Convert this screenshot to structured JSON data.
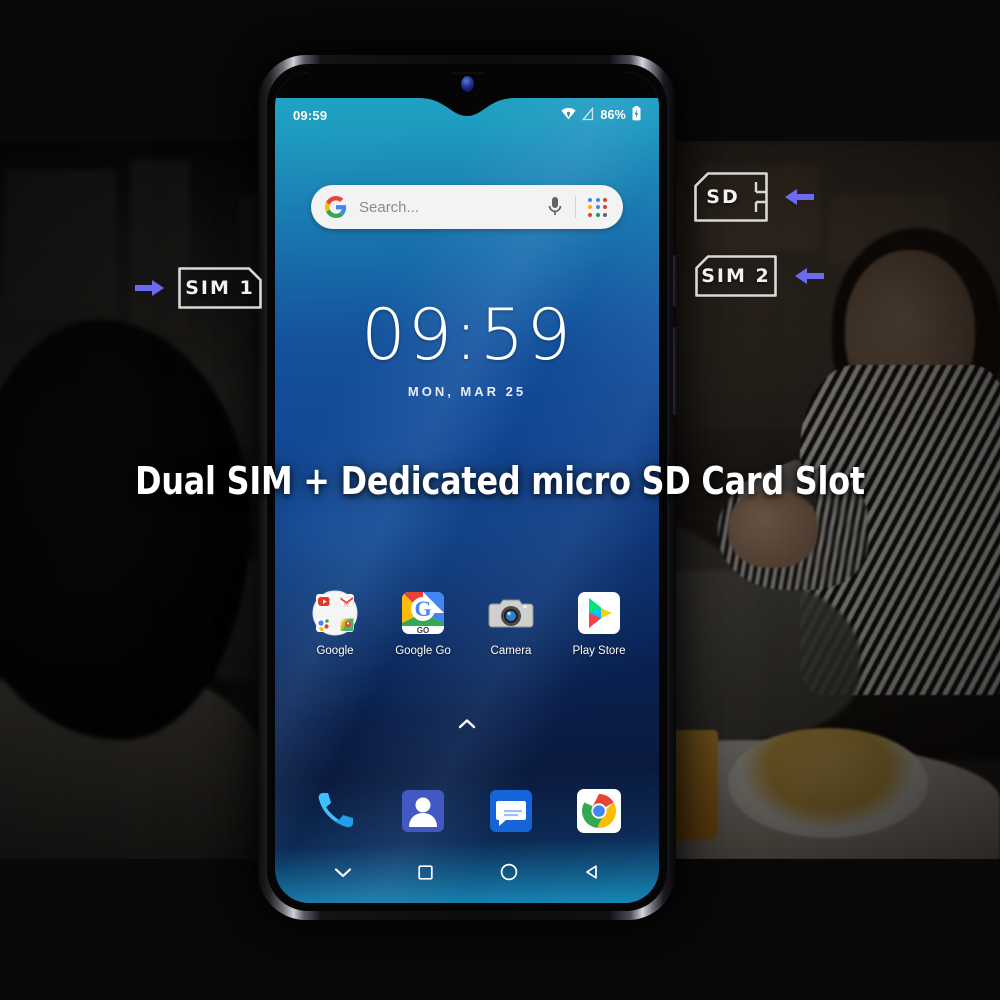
{
  "headline": "Dual SIM + Dedicated micro SD Card Slot",
  "colors": {
    "arrow": "#6b6bf0",
    "card_outline": "#d8d8d8",
    "screen_top": "#1fa7c4",
    "screen_mid": "#0d3a85",
    "screen_bottom": "#0a1a3e",
    "headline": "#ffffff"
  },
  "callouts": [
    {
      "id": "sim1",
      "label": "SIM 1",
      "arrow_direction": "right",
      "shape": "sim-card",
      "side": "left"
    },
    {
      "id": "sd",
      "label": "SD",
      "arrow_direction": "left",
      "shape": "sd-card",
      "side": "right"
    },
    {
      "id": "sim2",
      "label": "SIM 2",
      "arrow_direction": "left",
      "shape": "sim-card",
      "side": "right"
    }
  ],
  "phone": {
    "statusbar": {
      "time": "09:59",
      "wifi_icon": "wifi-icon",
      "signal_icon": "no-signal-icon",
      "battery_percent": "86%",
      "battery_icon": "battery-charging-icon"
    },
    "search": {
      "placeholder": "Search...",
      "google_icon": "google-g-icon",
      "mic_icon": "microphone-icon",
      "apps_icon": "google-apps-grid-icon"
    },
    "clock": {
      "time": "09:59",
      "date": "MON, MAR 25"
    },
    "apps": [
      {
        "label": "Google",
        "icon": "google-folder-icon"
      },
      {
        "label": "Google Go",
        "icon": "google-go-icon"
      },
      {
        "label": "Camera",
        "icon": "camera-icon"
      },
      {
        "label": "Play Store",
        "icon": "play-store-icon"
      }
    ],
    "drawer_handle_icon": "chevron-up-icon",
    "dock": [
      {
        "label": "Phone",
        "icon": "phone-icon"
      },
      {
        "label": "Contacts",
        "icon": "contacts-icon"
      },
      {
        "label": "Messages",
        "icon": "messages-icon"
      },
      {
        "label": "Chrome",
        "icon": "chrome-icon"
      }
    ],
    "navbar": [
      {
        "name": "hide-navbar",
        "icon": "chevron-down-icon"
      },
      {
        "name": "recents",
        "icon": "square-icon"
      },
      {
        "name": "home",
        "icon": "circle-icon"
      },
      {
        "name": "back",
        "icon": "triangle-left-icon"
      }
    ]
  }
}
